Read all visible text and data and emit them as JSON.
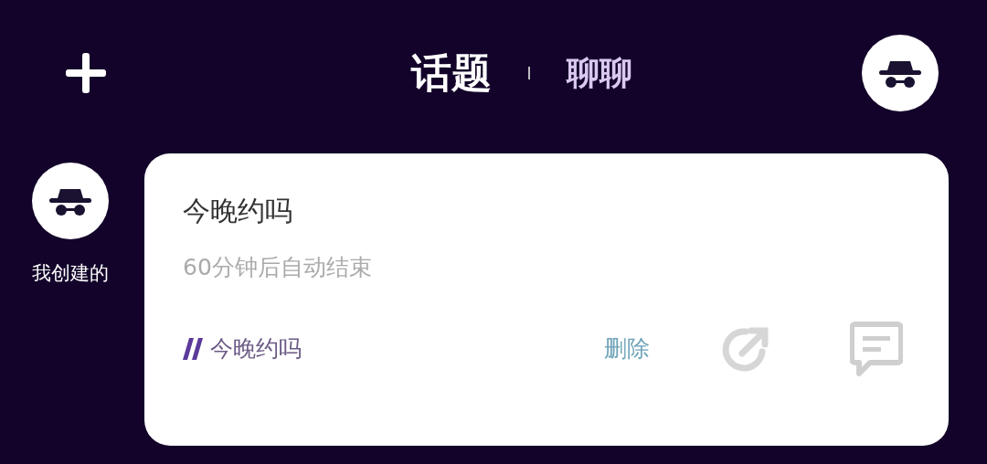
{
  "header": {
    "tabs": [
      {
        "label": "话题",
        "selected": true
      },
      {
        "label": "聊聊",
        "selected": false
      }
    ]
  },
  "sidebar": {
    "label": "我创建的"
  },
  "card": {
    "title": "今晚约吗",
    "subtitle": "60分钟后自动结束",
    "tag": "今晚约吗",
    "delete_label": "删除"
  }
}
